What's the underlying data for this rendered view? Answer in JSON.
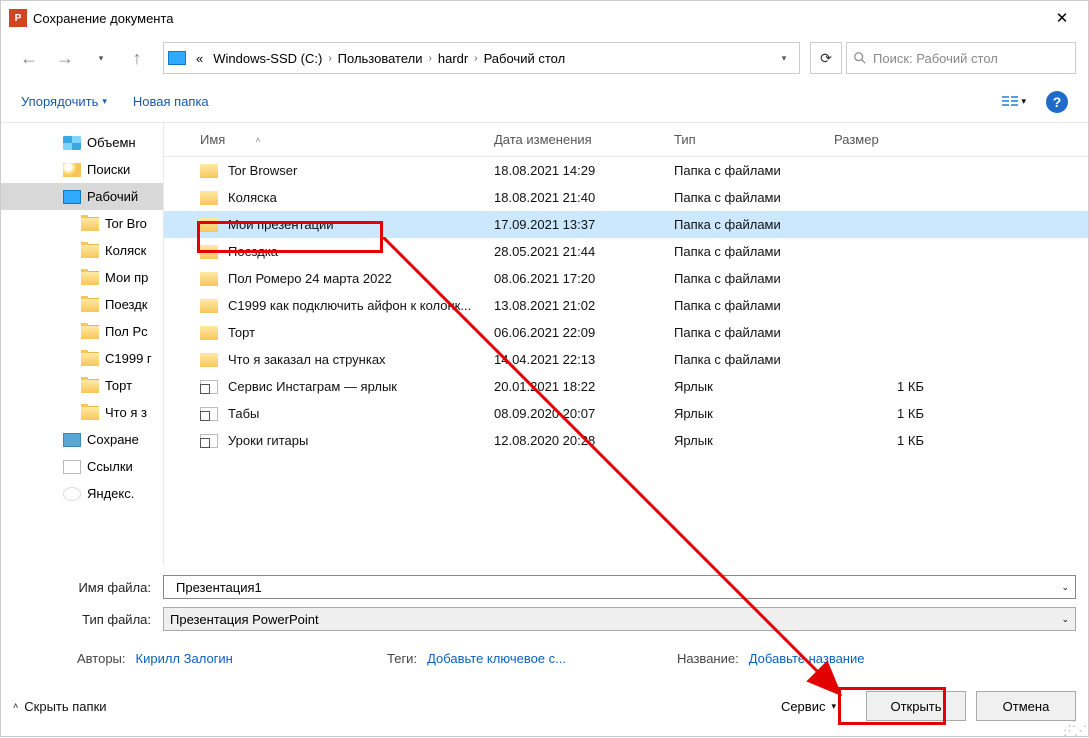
{
  "title": "Сохранение документа",
  "breadcrumb": {
    "pre": "«",
    "drive": "Windows-SSD (C:)",
    "p1": "Пользователи",
    "p2": "hardr",
    "p3": "Рабочий стол"
  },
  "search_placeholder": "Поиск: Рабочий стол",
  "toolbar": {
    "organize": "Упорядочить",
    "newfolder": "Новая папка"
  },
  "columns": {
    "name": "Имя",
    "date": "Дата изменения",
    "type": "Тип",
    "size": "Размер"
  },
  "sidebar": [
    {
      "icon": "disk",
      "label": "Объемн",
      "level": 0
    },
    {
      "icon": "search",
      "label": "Поиски",
      "level": 0
    },
    {
      "icon": "desktop",
      "label": "Рабочий",
      "level": 0,
      "selected": true
    },
    {
      "icon": "folder",
      "label": "Tor Bro",
      "level": 1
    },
    {
      "icon": "folder",
      "label": "Коляск",
      "level": 1
    },
    {
      "icon": "folder",
      "label": "Мои пр",
      "level": 1
    },
    {
      "icon": "folder",
      "label": "Поездк",
      "level": 1
    },
    {
      "icon": "folder",
      "label": "Пол Рс",
      "level": 1
    },
    {
      "icon": "folder",
      "label": "С1999 г",
      "level": 1
    },
    {
      "icon": "folder",
      "label": "Торт",
      "level": 1
    },
    {
      "icon": "folder",
      "label": "Что я з",
      "level": 1
    },
    {
      "icon": "save",
      "label": "Сохране",
      "level": 0
    },
    {
      "icon": "link",
      "label": "Ссылки",
      "level": 0
    },
    {
      "icon": "yandex",
      "label": "Яндекс.",
      "level": 0
    }
  ],
  "files": [
    {
      "icon": "folder",
      "name": "Tor Browser",
      "date": "18.08.2021 14:29",
      "type": "Папка с файлами",
      "size": ""
    },
    {
      "icon": "folder",
      "name": "Коляска",
      "date": "18.08.2021 21:40",
      "type": "Папка с файлами",
      "size": ""
    },
    {
      "icon": "folder",
      "name": "Мои презентации",
      "date": "17.09.2021 13:37",
      "type": "Папка с файлами",
      "size": "",
      "selected": true
    },
    {
      "icon": "folder",
      "name": "Поездка",
      "date": "28.05.2021 21:44",
      "type": "Папка с файлами",
      "size": ""
    },
    {
      "icon": "folder",
      "name": "Пол Ромеро 24 марта 2022",
      "date": "08.06.2021 17:20",
      "type": "Папка с файлами",
      "size": ""
    },
    {
      "icon": "folder",
      "name": "С1999 как подключить айфон к колонк...",
      "date": "13.08.2021 21:02",
      "type": "Папка с файлами",
      "size": ""
    },
    {
      "icon": "folder",
      "name": "Торт",
      "date": "06.06.2021 22:09",
      "type": "Папка с файлами",
      "size": ""
    },
    {
      "icon": "folder",
      "name": "Что я заказал на струнках",
      "date": "14.04.2021 22:13",
      "type": "Папка с файлами",
      "size": ""
    },
    {
      "icon": "shortcut",
      "name": "Сервис Инстаграм — ярлык",
      "date": "20.01.2021 18:22",
      "type": "Ярлык",
      "size": "1 КБ"
    },
    {
      "icon": "shortcut",
      "name": "Табы",
      "date": "08.09.2020 20:07",
      "type": "Ярлык",
      "size": "1 КБ"
    },
    {
      "icon": "shortcut",
      "name": "Уроки гитары",
      "date": "12.08.2020 20:28",
      "type": "Ярлык",
      "size": "1 КБ"
    }
  ],
  "filename": {
    "label": "Имя файла:",
    "value": "Презентация1"
  },
  "filetype": {
    "label": "Тип файла:",
    "value": "Презентация PowerPoint"
  },
  "meta": {
    "authors_lbl": "Авторы:",
    "authors_val": "Кирилл Залогин",
    "tags_lbl": "Теги:",
    "tags_val": "Добавьте ключевое с...",
    "title_lbl": "Название:",
    "title_val": "Добавьте название"
  },
  "actions": {
    "hide": "Скрыть папки",
    "service": "Сервис",
    "open": "Открыть",
    "cancel": "Отмена"
  }
}
